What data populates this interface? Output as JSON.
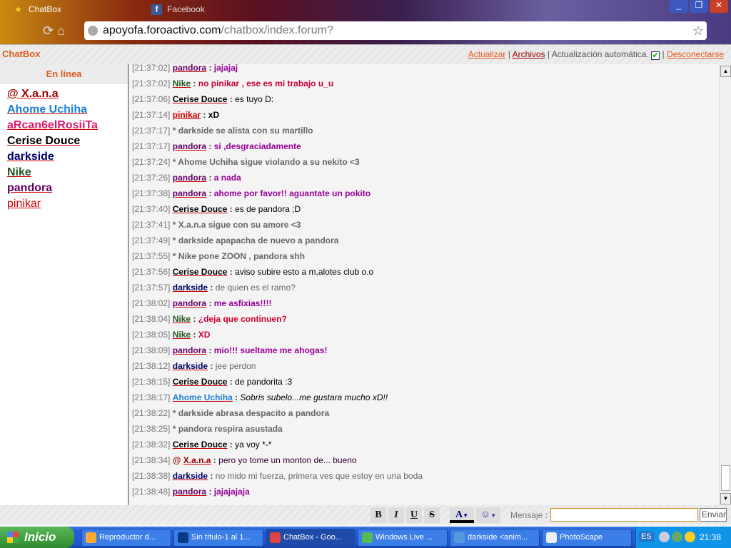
{
  "browser": {
    "tabs": [
      {
        "label": "ChatBox",
        "icon": "star-icon"
      },
      {
        "label": "Facebook",
        "icon": "facebook-icon"
      }
    ],
    "url_host": "apoyofa.foroactivo.com",
    "url_path": "/chatbox/index.forum?"
  },
  "header": {
    "title": "ChatBox",
    "refresh": "Actualizar",
    "archives": "Archivos",
    "auto_update": "Actualización automática.",
    "auto_update_checked": true,
    "disconnect": "Desconectarse",
    "sep": "|"
  },
  "sidebar": {
    "title": "En línea",
    "users": [
      {
        "name": "@ X.a.n.a",
        "color": "#990000"
      },
      {
        "name": "Ahome Uchiha",
        "color": "#1e7fd6"
      },
      {
        "name": "aRcan6elRosiiTa",
        "color": "#e0186c"
      },
      {
        "name": "Cerise Douce",
        "color": "#000000"
      },
      {
        "name": "darkside",
        "color": "#000066"
      },
      {
        "name": "Nike",
        "color": "#225522"
      },
      {
        "name": "pandora",
        "color": "#660066"
      },
      {
        "name": "pinikar",
        "color": "#cc0000",
        "normal": true
      }
    ]
  },
  "messages": [
    {
      "time": "[21:37:02]",
      "user": "pandora",
      "text": "jajajaj"
    },
    {
      "time": "[21:37:02]",
      "user": "Nike",
      "text": "no pinikar , ese es mi trabajo u_u"
    },
    {
      "time": "[21:37:06]",
      "user": "Cerise Douce",
      "text": "es tuyo D:"
    },
    {
      "time": "[21:37:14]",
      "user": "pinikar",
      "text": "xD"
    },
    {
      "time": "[21:37:17]",
      "action": "* darkside se alista con su martillo"
    },
    {
      "time": "[21:37:17]",
      "user": "pandora",
      "text": "si ,desgraciadamente"
    },
    {
      "time": "[21:37:24]",
      "action": "* Ahome Uchiha sigue violando a su nekito <3"
    },
    {
      "time": "[21:37:26]",
      "user": "pandora",
      "text": "a nada"
    },
    {
      "time": "[21:37:38]",
      "user": "pandora",
      "text": "ahome por favor!! aguantate un pokito"
    },
    {
      "time": "[21:37:40]",
      "user": "Cerise Douce",
      "text": "es de pandora ;D"
    },
    {
      "time": "[21:37:41]",
      "action": "* X.a.n.a sigue con su amore <3"
    },
    {
      "time": "[21:37:49]",
      "action": "* darkside apapacha de nuevo a pandora"
    },
    {
      "time": "[21:37:55]",
      "action": "* Nike pone ZOON , pandora shh"
    },
    {
      "time": "[21:37:56]",
      "user": "Cerise Douce",
      "text": "aviso subire esto a m,alotes club o.o"
    },
    {
      "time": "[21:37:57]",
      "user": "darkside",
      "text": "de quien es el ramo?"
    },
    {
      "time": "[21:38:02]",
      "user": "pandora",
      "text": "me asfixias!!!!"
    },
    {
      "time": "[21:38:04]",
      "user": "Nike",
      "text": "¿deja que continuen?"
    },
    {
      "time": "[21:38:05]",
      "user": "Nike",
      "text": "XD"
    },
    {
      "time": "[21:38:09]",
      "user": "pandora",
      "text": "mio!!! sueltame me ahogas!"
    },
    {
      "time": "[21:38:12]",
      "user": "darkside",
      "text": "jee perdon"
    },
    {
      "time": "[21:38:15]",
      "user": "Cerise Douce",
      "text": "de pandorita :3"
    },
    {
      "time": "[21:38:17]",
      "user": "Ahome Uchiha",
      "text": "Sobris subelo...me gustara mucho xD!!"
    },
    {
      "time": "[21:38:22]",
      "action": "* darkside abrasa despacito a pandora"
    },
    {
      "time": "[21:38:25]",
      "action": "* pandora respira asustada"
    },
    {
      "time": "[21:38:32]",
      "user": "Cerise Douce",
      "text": "ya voy *-*"
    },
    {
      "time": "[21:38:34]",
      "user": "X.a.n.a",
      "prefix": "@",
      "text": "pero yo tome un monton de... bueno"
    },
    {
      "time": "[21:38:38]",
      "user": "darkside",
      "text": "no mido mi fuerza, primera ves que estoy en una boda"
    },
    {
      "time": "[21:38:48]",
      "user": "pandora",
      "text": "jajajajaja"
    }
  ],
  "styles": {
    "pandora": {
      "user": "#660066",
      "text": "#990099",
      "bold": true
    },
    "Nike": {
      "user": "#225522",
      "text": "#cc0033",
      "bold": true
    },
    "Cerise Douce": {
      "user": "#000000",
      "text": "#000000",
      "bold": false
    },
    "pinikar": {
      "user": "#cc0000",
      "text": "#000000",
      "bold": true
    },
    "darkside": {
      "user": "#000066",
      "text": "#666666",
      "bold": false
    },
    "Ahome Uchiha": {
      "user": "#1e7fd6",
      "text": "#000000",
      "bold": false,
      "italic": true
    },
    "X.a.n.a": {
      "user": "#990000",
      "text": "#330033",
      "bold": false
    },
    "action": {
      "text": "#666666",
      "bold": true
    }
  },
  "toolbar": {
    "bold": "B",
    "italic": "I",
    "underline": "U",
    "strike": "S",
    "color": "A",
    "smiley": "☺",
    "message_label": "Mensaje :",
    "message_value": "",
    "send": "Enviar"
  },
  "taskbar": {
    "start": "Inicio",
    "items": [
      {
        "label": "Reproductor d...",
        "icon": "media-player-icon"
      },
      {
        "label": "Sin título-1 al 1...",
        "icon": "photoshop-icon"
      },
      {
        "label": "ChatBox - Goo...",
        "icon": "chrome-icon",
        "active": true
      },
      {
        "label": "Windows Live ...",
        "icon": "messenger-icon"
      },
      {
        "label": "darkside <anim...",
        "icon": "messenger-chat-icon"
      },
      {
        "label": "PhotoScape",
        "icon": "photoscape-icon"
      }
    ],
    "lang": "ES",
    "clock": "21:38"
  }
}
